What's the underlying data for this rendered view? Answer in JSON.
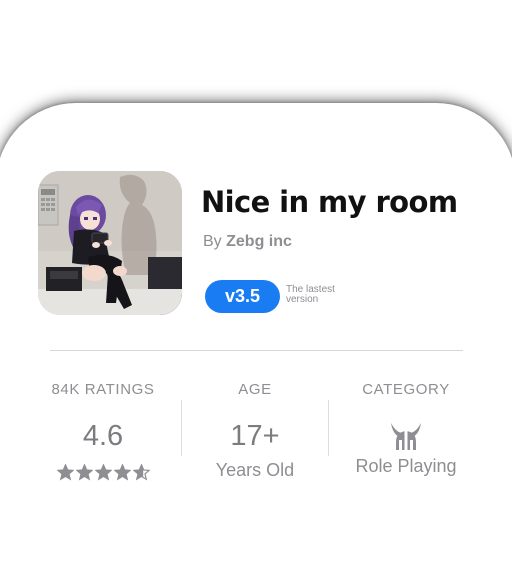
{
  "app": {
    "title": "Nice in my room",
    "developer_prefix": "By",
    "developer_name": "Zebg inc",
    "version": "v3.5",
    "version_note": "The lastest version"
  },
  "stats": {
    "ratings": {
      "label": "84K RATINGS",
      "value": "4.6",
      "stars": 4.6
    },
    "age": {
      "label": "AGE",
      "value": "17+",
      "sub": "Years Old"
    },
    "category": {
      "label": "CATEGORY",
      "icon": "viking-helmet-icon",
      "sub": "Role Playing"
    }
  },
  "colors": {
    "accent": "#1a7cf3",
    "muted_text": "#8e8e93",
    "star": "#8e8e93"
  }
}
